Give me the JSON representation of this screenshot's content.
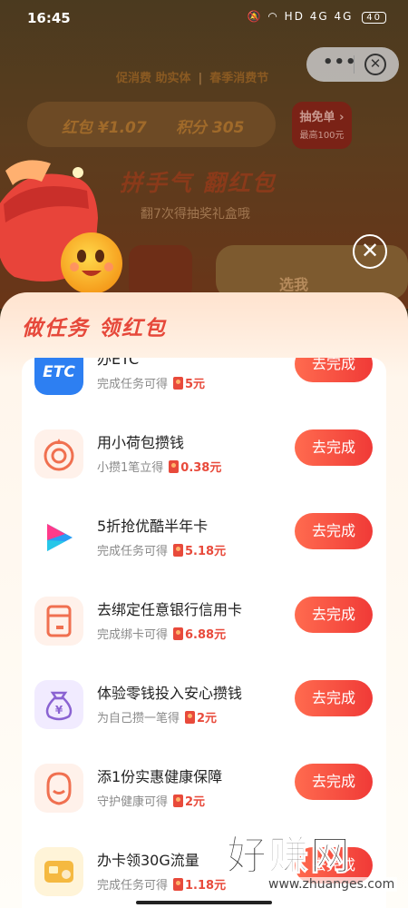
{
  "status_bar": {
    "time": "16:45",
    "signal_text": "HD 4G 4G",
    "battery": "40"
  },
  "mini_program": {
    "more_label": "•••",
    "close_label": "✕"
  },
  "header": {
    "slogan_left": "促消费 助实体",
    "slogan_right": "春季消费节",
    "redpacket_label": "红包 ¥1.07",
    "points_label": "积分 305",
    "lottery_title": "抽免单 ›",
    "lottery_sub": "最高100元",
    "game_title": "拼手气 翻红包",
    "game_subtitle": "翻7次得抽奖礼盒哦",
    "pick_label": "选我"
  },
  "popup": {
    "close_label": "✕",
    "title": "做任务 领红包"
  },
  "tasks": [
    {
      "name": "办ETC",
      "sub": "完成任务可得",
      "amount": "5元",
      "button": "去完成",
      "icon": "etc-icon",
      "icon_text": "ETC",
      "icon_color": "#2d7ff2"
    },
    {
      "name": "用小荷包攒钱",
      "sub": "小攒1笔立得",
      "amount": "0.38元",
      "button": "去完成",
      "icon": "savings-target-icon",
      "icon_text": "",
      "icon_color": "#f4a28a"
    },
    {
      "name": "5折抢优酷半年卡",
      "sub": "完成任务可得",
      "amount": "5.18元",
      "button": "去完成",
      "icon": "youku-play-icon",
      "icon_text": "",
      "icon_color": "#1e90ff"
    },
    {
      "name": "去绑定任意银行信用卡",
      "sub": "完成绑卡可得",
      "amount": "6.88元",
      "button": "去完成",
      "icon": "credit-card-icon",
      "icon_text": "",
      "icon_color": "#f4a28a"
    },
    {
      "name": "体验零钱投入安心攒钱",
      "sub": "为自己攒一笔得",
      "amount": "2元",
      "button": "去完成",
      "icon": "money-bag-icon",
      "icon_text": "¥",
      "icon_color": "#8a63d2"
    },
    {
      "name": "添1份实惠健康保障",
      "sub": "守护健康可得",
      "amount": "2元",
      "button": "去完成",
      "icon": "health-shield-icon",
      "icon_text": "",
      "icon_color": "#f4a28a"
    },
    {
      "name": "办卡领30G流量",
      "sub": "完成任务可得",
      "amount": "1.18元",
      "button": "去完成",
      "icon": "sim-card-icon",
      "icon_text": "",
      "icon_color": "#f5b940"
    }
  ],
  "watermark": {
    "logo": "好赚网",
    "url": "www.zhuanges.com"
  }
}
